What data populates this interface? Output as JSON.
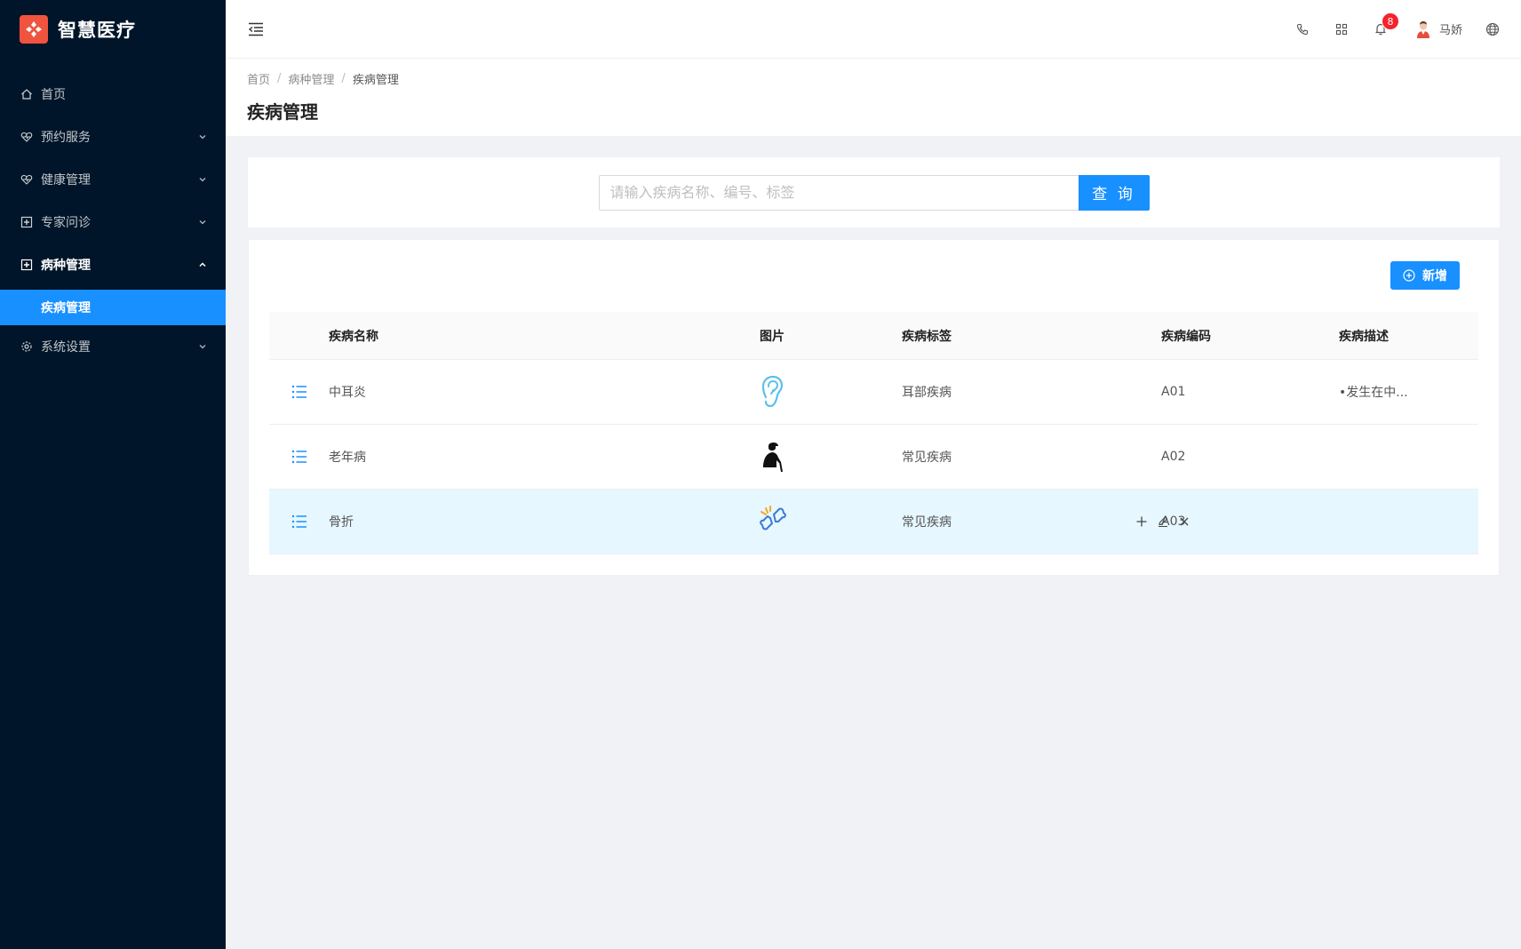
{
  "app": {
    "name": "智慧医疗"
  },
  "sidebar": {
    "items": [
      {
        "label": "首页",
        "icon": "home-icon"
      },
      {
        "label": "预约服务",
        "icon": "heart-pulse-icon"
      },
      {
        "label": "健康管理",
        "icon": "heart-pulse-icon"
      },
      {
        "label": "专家问诊",
        "icon": "medical-plus-icon"
      },
      {
        "label": "病种管理",
        "icon": "medical-plus-icon",
        "expanded": true,
        "children": [
          {
            "label": "疾病管理",
            "active": true
          }
        ]
      },
      {
        "label": "系统设置",
        "icon": "gear-icon"
      }
    ]
  },
  "header": {
    "notifications": "8",
    "user_name": "马娇"
  },
  "breadcrumb": [
    "首页",
    "病种管理",
    "疾病管理"
  ],
  "page_title": "疾病管理",
  "search": {
    "placeholder": "请输入疾病名称、编号、标签",
    "value": "",
    "button": "查 询"
  },
  "add_button": "新增",
  "table": {
    "columns": [
      "疾病名称",
      "图片",
      "疾病标签",
      "疾病编码",
      "疾病描述"
    ],
    "rows": [
      {
        "name": "中耳炎",
        "image": "ear-icon",
        "tag": "耳部疾病",
        "code": "A01",
        "desc": "•发生在中..."
      },
      {
        "name": "老年病",
        "image": "elderly-person-icon",
        "tag": "常见疾病",
        "code": "A02",
        "desc": ""
      },
      {
        "name": "骨折",
        "image": "broken-bone-icon",
        "tag": "常见疾病",
        "code": "A03",
        "desc": "",
        "selected": true
      }
    ]
  },
  "colors": {
    "sidebar_bg": "#001529",
    "primary": "#1890ff",
    "badge": "#f5222d",
    "logo": "#f0533e",
    "selected_row": "#e6f7ff"
  }
}
